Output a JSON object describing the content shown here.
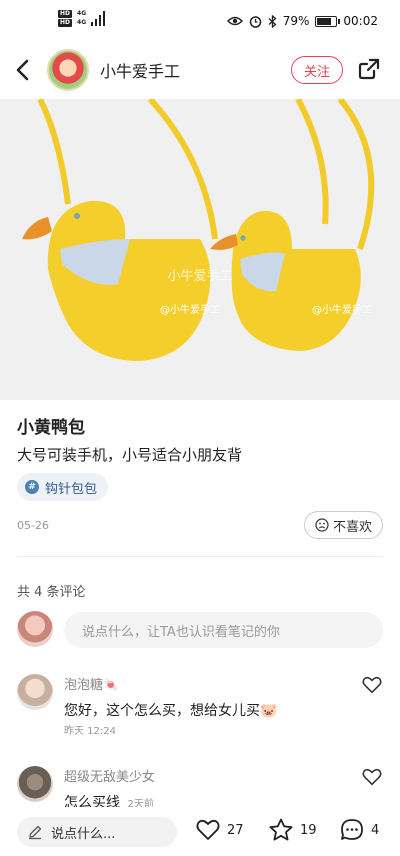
{
  "status_bar": {
    "hd1": "HD",
    "hd2": "HD",
    "signal1": "4G",
    "signal2": "4G",
    "battery_percent": "79%",
    "battery_level": 0.79,
    "time": "00:02"
  },
  "nav": {
    "author_name": "小牛爱手工",
    "follow_label": "关注"
  },
  "post": {
    "title": "小黄鸭包",
    "description": "大号可装手机，小号适合小朋友背",
    "tag_icon": "#",
    "tag": "钩针包包",
    "date": "05-26",
    "dislike_label": "不喜欢",
    "image_watermark_center": "小牛爱手工",
    "image_watermark_left": "@小牛爱手工",
    "image_watermark_right": "@小牛爱手工"
  },
  "comments_section": {
    "count_text": "共 4 条评论",
    "input_placeholder": "说点什么，让TA也认识看笔记的你",
    "items": [
      {
        "name": "泡泡糖🍬",
        "text": "您好，这个怎么买，想给女儿买🐷",
        "time": "昨天 12:24"
      },
      {
        "name": "超级无敌美少女",
        "text": "怎么买线",
        "time": "2天前"
      }
    ]
  },
  "bottom_bar": {
    "input_label": "说点什么...",
    "likes": "27",
    "collects": "19",
    "comments": "4"
  },
  "colors": {
    "accent": "#e8425a",
    "tag_text": "#2f5b8e",
    "duck_yellow": "#f4cf2c"
  }
}
